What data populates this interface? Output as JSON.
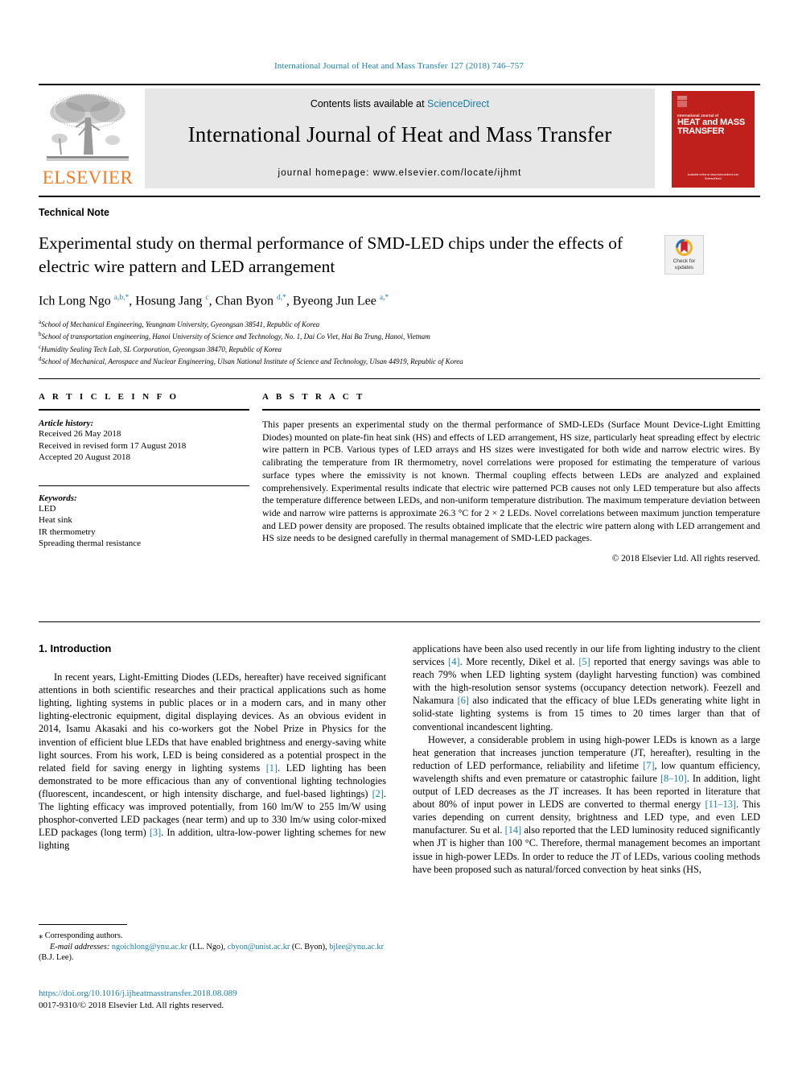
{
  "running_head": "International Journal of Heat and Mass Transfer 127 (2018) 746–757",
  "masthead": {
    "contents_prefix": "Contents lists available at ",
    "sciencedirect": "ScienceDirect",
    "journal_title": "International Journal of Heat and Mass Transfer",
    "homepage": "journal homepage: www.elsevier.com/locate/ijhmt",
    "publisher_wordmark": "ELSEVIER",
    "publisher_color": "#f47a20",
    "link_color": "#1a7fa8",
    "cover": {
      "superline": "International Journal of",
      "title_line1": "HEAT and MASS",
      "title_line2": "TRANSFER",
      "footer_line1": "Available online at www.sciencedirect.com",
      "footer_line2": "ScienceDirect",
      "background_color": "#c0201b"
    }
  },
  "article": {
    "doctype": "Technical Note",
    "title": "Experimental study on thermal performance of SMD-LED chips under the effects of electric wire pattern and LED arrangement",
    "crossmark_line1": "Check for",
    "crossmark_line2": "updates",
    "authors_html": "Ich Long Ngo <sup>a,b,*</sup>, Hosung Jang <sup>c</sup>, Chan Byon <sup>d,*</sup>, Byeong Jun Lee <sup>a,*</sup>",
    "affiliations": [
      {
        "marker": "a",
        "text": "School of Mechanical Engineering, Yeungnam University, Gyeongsan 38541, Republic of Korea"
      },
      {
        "marker": "b",
        "text": "School of transportation engineering, Hanoi University of Science and Technology, No. 1, Dai Co Viet, Hai Ba Trung, Hanoi, Vietnam"
      },
      {
        "marker": "c",
        "text": "Humidity Sealing Tech Lab, SL Corporation, Gyeongsan 38470, Republic of Korea"
      },
      {
        "marker": "d",
        "text": "School of Mechanical, Aerospace and Nuclear Engineering, Ulsan National Institute of Science and Technology, Ulsan 44919, Republic of Korea"
      }
    ]
  },
  "article_info": {
    "heading": "A R T I C L E  I N F O",
    "history_heading": "Article history:",
    "history": [
      "Received 26 May 2018",
      "Received in revised form 17 August 2018",
      "Accepted 20 August 2018"
    ],
    "keywords_heading": "Keywords:",
    "keywords": [
      "LED",
      "Heat sink",
      "IR thermometry",
      "Spreading thermal resistance"
    ]
  },
  "abstract": {
    "heading": "A B S T R A C T",
    "text": "This paper presents an experimental study on the thermal performance of SMD-LEDs (Surface Mount Device-Light Emitting Diodes) mounted on plate-fin heat sink (HS) and effects of LED arrangement, HS size, particularly heat spreading effect by electric wire pattern in PCB. Various types of LED arrays and HS sizes were investigated for both wide and narrow electric wires. By calibrating the temperature from IR thermometry, novel correlations were proposed for estimating the temperature of various surface types where the emissivity is not known. Thermal coupling effects between LEDs are analyzed and explained comprehensively. Experimental results indicate that electric wire patterned PCB causes not only LED temperature but also affects the temperature difference between LEDs, and non-uniform temperature distribution. The maximum temperature deviation between wide and narrow wire patterns is approximate 26.3 °C for 2 × 2 LEDs. Novel correlations between maximum junction temperature and LED power density are proposed. The results obtained implicate that the electric wire pattern along with LED arrangement and HS size needs to be designed carefully in thermal management of SMD-LED packages.",
    "copyright": "© 2018 Elsevier Ltd. All rights reserved."
  },
  "body": {
    "section_heading": "1. Introduction",
    "left_paragraph_1_a": "In recent years, Light-Emitting Diodes (LEDs, hereafter) have received significant attentions in both scientific researches and their practical applications such as home lighting, lighting systems in public places or in a modern cars, and in many other lighting-electronic equipment, digital displaying devices. As an obvious evident in 2014, Isamu Akasaki and his co-workers got the Nobel Prize in Physics for the invention of efficient blue LEDs that have enabled brightness and energy-saving white light sources. From his work, LED is being considered as a potential prospect in the related field for saving energy in lighting systems ",
    "left_ref_1": "[1]",
    "left_paragraph_1_b": ". LED lighting has been demonstrated to be more efficacious than any of conventional lighting technologies (fluorescent, incandescent, or high intensity discharge, and fuel-based lightings) ",
    "left_ref_2": "[2]",
    "left_paragraph_1_c": ". The lighting efficacy was improved potentially, from 160 lm/W to 255 lm/W using phosphor-converted LED packages (near term) and up to 330 lm/w using color-mixed LED packages (long term) ",
    "left_ref_3": "[3]",
    "left_paragraph_1_d": ". In addition, ultra-low-power lighting schemes for new lighting",
    "right_paragraph_1_a": "applications have been also used recently in our life from lighting industry to the client services ",
    "right_ref_4": "[4]",
    "right_paragraph_1_b": ". More recently, Dikel et al. ",
    "right_ref_5": "[5]",
    "right_paragraph_1_c": " reported that energy savings was able to reach 79% when LED lighting system (daylight harvesting function) was combined with the high-resolution sensor systems (occupancy detection network). Feezell and Nakamura ",
    "right_ref_6": "[6]",
    "right_paragraph_1_d": " also indicated that the efficacy of blue LEDs generating white light in solid-state lighting systems is from 15 times to 20 times larger than that of conventional incandescent lighting.",
    "right_paragraph_2_a": "However, a considerable problem in using high-power LEDs is known as a large heat generation that increases junction temperature (JT, hereafter), resulting in the reduction of LED performance, reliability and lifetime ",
    "right_ref_7": "[7]",
    "right_paragraph_2_b": ", low quantum efficiency, wavelength shifts and even premature or catastrophic failure ",
    "right_ref_8": "[8–10]",
    "right_paragraph_2_c": ". In addition, light output of LED decreases as the JT increases. It has been reported in literature that about 80% of input power in LEDS are converted to thermal energy ",
    "right_ref_9": "[11–13]",
    "right_paragraph_2_d": ". This varies depending on current density, brightness and LED type, and even LED manufacturer. Su et al. ",
    "right_ref_10": "[14]",
    "right_paragraph_2_e": " also reported that the LED luminosity reduced significantly when JT is higher than 100 °C. Therefore, thermal management becomes an important issue in high-power LEDs. In order to reduce the JT of LEDs, various cooling methods have been proposed such as natural/forced convection by heat sinks (HS,"
  },
  "footer": {
    "corresponding_marker": "⁎",
    "corresponding_text": "Corresponding authors.",
    "email_label": "E-mail addresses:",
    "email_1": "ngoichlong@ynu.ac.kr",
    "email_1_owner": "(I.L. Ngo),",
    "email_2": "cbyon@unist.ac.kr",
    "email_2_owner": "(C. Byon),",
    "email_3": "bjlee@ynu.ac.kr",
    "email_3_owner": "(B.J. Lee).",
    "doi": "https://doi.org/10.1016/j.ijheatmasstransfer.2018.08.089",
    "issn": "0017-9310/© 2018 Elsevier Ltd. All rights reserved."
  }
}
